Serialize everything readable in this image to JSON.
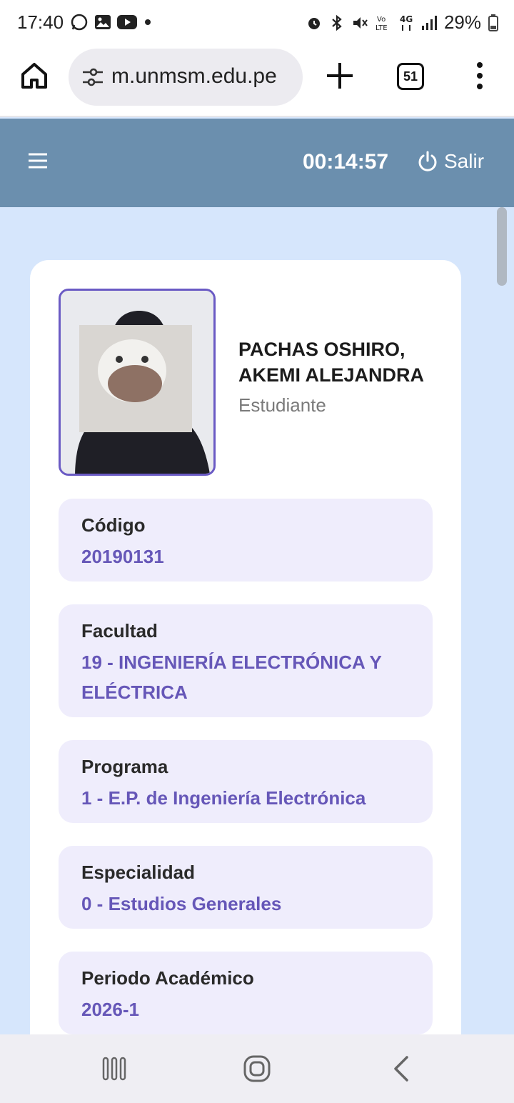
{
  "status": {
    "time": "17:40",
    "battery": "29%",
    "left_icons": [
      "whatsapp-icon",
      "gallery-icon",
      "youtube-icon",
      "dot-icon"
    ],
    "right_icons": [
      "alarm-icon",
      "bluetooth-icon",
      "mute-icon",
      "volte-icon",
      "4g-icon",
      "signal-icon",
      "battery-icon"
    ]
  },
  "browser": {
    "url": "m.unmsm.edu.pe",
    "tab_count": "51"
  },
  "header": {
    "timer": "00:14:57",
    "logout_label": "Salir"
  },
  "profile": {
    "name_line1": "PACHAS OSHIRO,",
    "name_line2": "AKEMI ALEJANDRA",
    "role": "Estudiante"
  },
  "fields": [
    {
      "label": "Código",
      "value": "20190131"
    },
    {
      "label": "Facultad",
      "value": "19 - INGENIERÍA ELECTRÓNICA Y ELÉCTRICA"
    },
    {
      "label": "Programa",
      "value": "1 - E.P. de Ingeniería Electrónica"
    },
    {
      "label": "Especialidad",
      "value": "0 - Estudios Generales"
    },
    {
      "label": "Periodo Académico",
      "value": "2026-1"
    }
  ],
  "colors": {
    "header_bg": "#6b8fae",
    "page_bg": "#d6e6fc",
    "accent": "#6657b8",
    "field_bg": "#efedfc"
  }
}
